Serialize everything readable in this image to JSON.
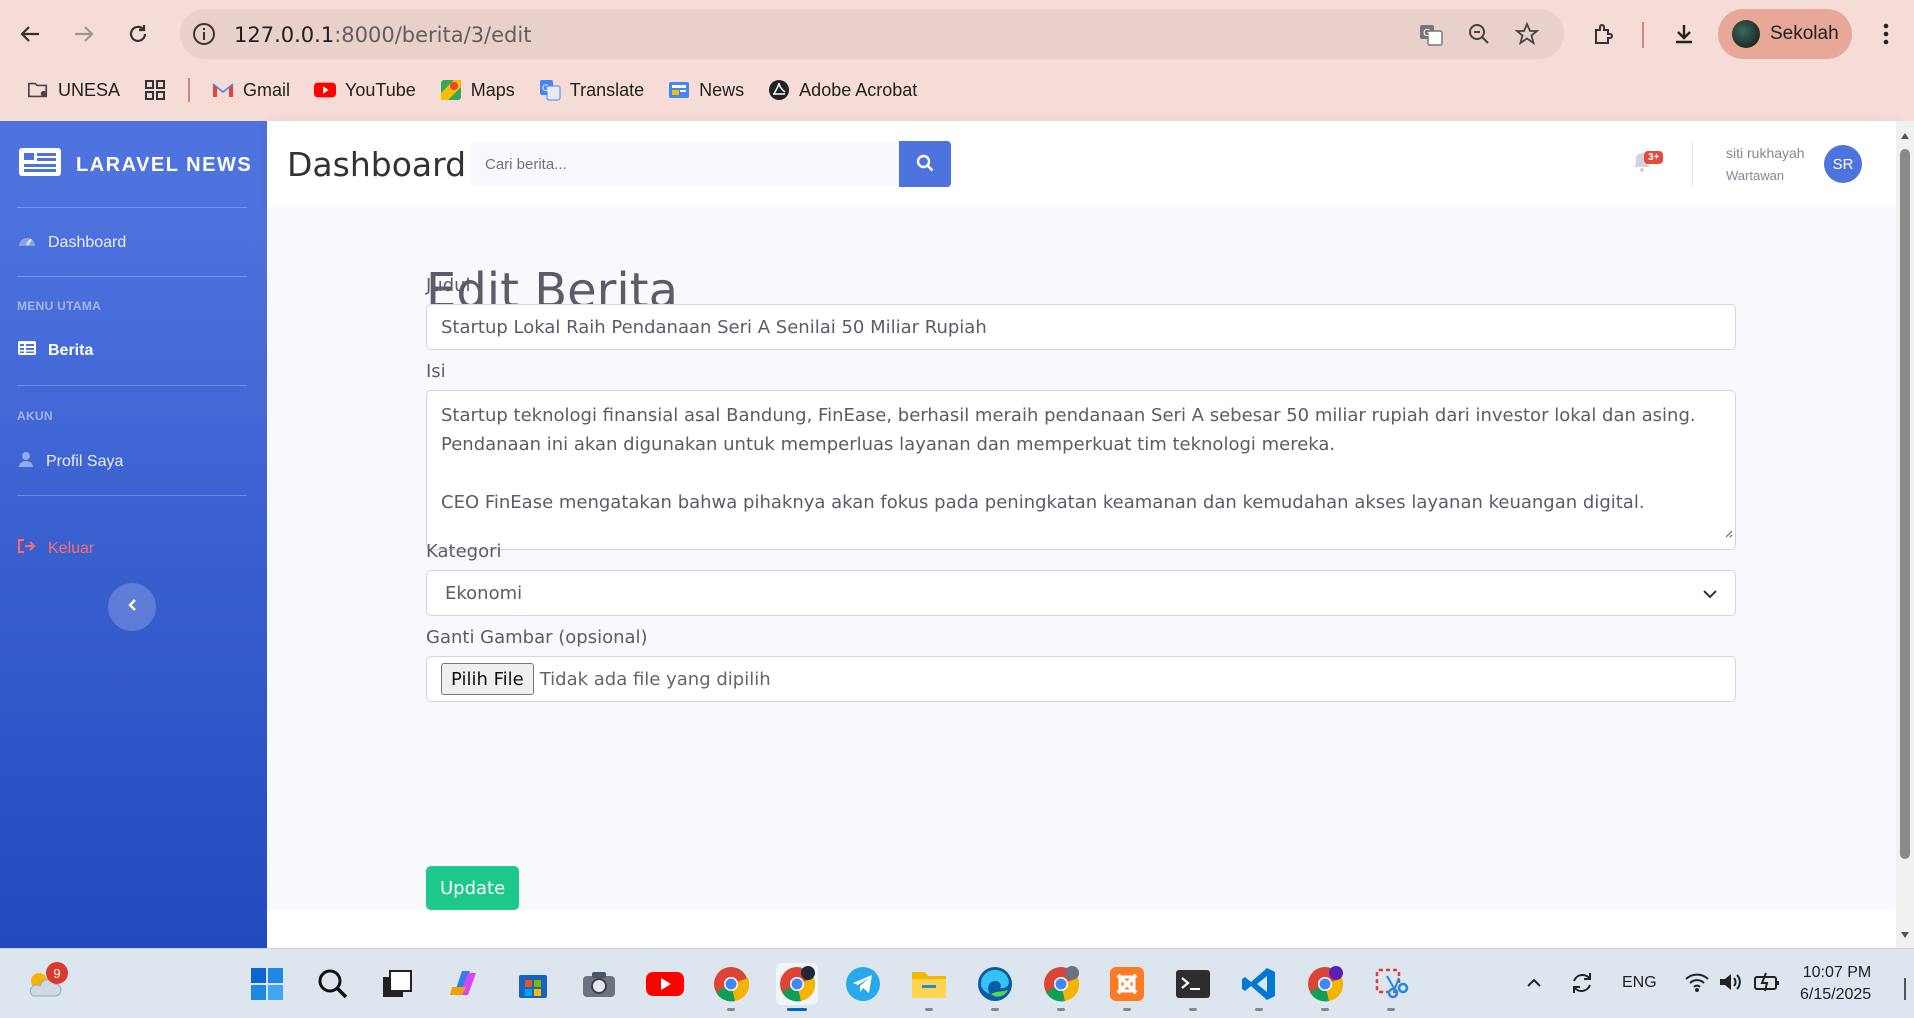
{
  "browser": {
    "url_host": "127.0.0.1",
    "url_path": ":8000/berita/3/edit",
    "profile_name": "Sekolah",
    "bookmarks": [
      {
        "label": "UNESA",
        "icon": "folder-icon"
      },
      {
        "label": "Gmail",
        "icon": "gmail-icon"
      },
      {
        "label": "YouTube",
        "icon": "youtube-icon"
      },
      {
        "label": "Maps",
        "icon": "maps-icon"
      },
      {
        "label": "Translate",
        "icon": "translate-icon"
      },
      {
        "label": "News",
        "icon": "news-icon"
      },
      {
        "label": "Adobe Acrobat",
        "icon": "acrobat-icon"
      }
    ]
  },
  "sidebar": {
    "brand": "LARAVEL NEWS",
    "dashboard": "Dashboard",
    "heading_main": "MENU UTAMA",
    "berita": "Berita",
    "heading_account": "AKUN",
    "profile": "Profil Saya",
    "logout": "Keluar"
  },
  "topbar": {
    "title": "Dashboard",
    "search_placeholder": "Cari berita...",
    "notification_badge": "3+",
    "user_name": "siti rukhayah",
    "user_role": "Wartawan",
    "user_initials": "SR"
  },
  "form": {
    "title": "Edit Berita",
    "judul_label": "Judul",
    "judul_value": "Startup Lokal Raih Pendanaan Seri A Senilai 50 Miliar Rupiah",
    "isi_label": "Isi",
    "isi_value": "Startup teknologi finansial asal Bandung, FinEase, berhasil meraih pendanaan Seri A sebesar 50 miliar rupiah dari investor lokal dan asing.\nPendanaan ini akan digunakan untuk memperluas layanan dan memperkuat tim teknologi mereka.\n\nCEO FinEase mengatakan bahwa pihaknya akan fokus pada peningkatan keamanan dan kemudahan akses layanan keuangan digital.",
    "kategori_label": "Kategori",
    "kategori_value": "Ekonomi",
    "gambar_label": "Ganti Gambar (opsional)",
    "file_button": "Pilih File",
    "file_status": "Tidak ada file yang dipilih",
    "submit": "Update"
  },
  "taskbar": {
    "weather_badge": "9",
    "language": "ENG",
    "time": "10:07 PM",
    "date": "6/15/2025",
    "apps": [
      "start-icon",
      "search-icon",
      "task-view-icon",
      "copilot-icon",
      "store-icon",
      "camera-icon",
      "youtube-icon",
      "chrome-icon",
      "chrome-active-icon",
      "telegram-icon",
      "file-explorer-icon",
      "edge-icon",
      "chrome-profile-icon",
      "xampp-icon",
      "terminal-icon",
      "vscode-icon",
      "chrome-profile2-icon",
      "snipping-tool-icon"
    ]
  },
  "colors": {
    "primary": "#4e73df",
    "success": "#1cc88a",
    "danger": "#e74a3b",
    "chrome_bg": "#f6dcd6"
  }
}
